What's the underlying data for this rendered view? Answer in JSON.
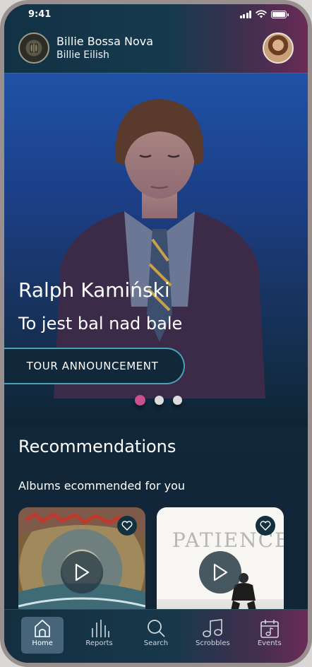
{
  "status_bar": {
    "time": "9:41"
  },
  "now_playing": {
    "track": "Billie Bossa Nova",
    "artist": "Billie Eilish"
  },
  "hero": {
    "artist": "Ralph Kamiński",
    "title": "To jest bal nad bale",
    "button_label": "TOUR ANNOUNCEMENT",
    "carousel_pages": 3,
    "carousel_active_index": 0
  },
  "recommendations": {
    "title": "Recommendations",
    "subtitle": "Albums ecommended for you",
    "albums": [
      {
        "cover_text": ""
      },
      {
        "cover_text": "PATIENCE"
      }
    ]
  },
  "bottom_nav": {
    "items": [
      {
        "label": "Home",
        "icon": "home-icon",
        "active": true
      },
      {
        "label": "Reports",
        "icon": "bar-chart-icon",
        "active": false
      },
      {
        "label": "Search",
        "icon": "search-icon",
        "active": false
      },
      {
        "label": "Scrobbles",
        "icon": "music-note-icon",
        "active": false
      },
      {
        "label": "Events",
        "icon": "calendar-icon",
        "active": false
      }
    ]
  },
  "colors": {
    "accent_pink": "#c9508c",
    "button_border": "#4aa0b6",
    "background": "#0f2434"
  }
}
